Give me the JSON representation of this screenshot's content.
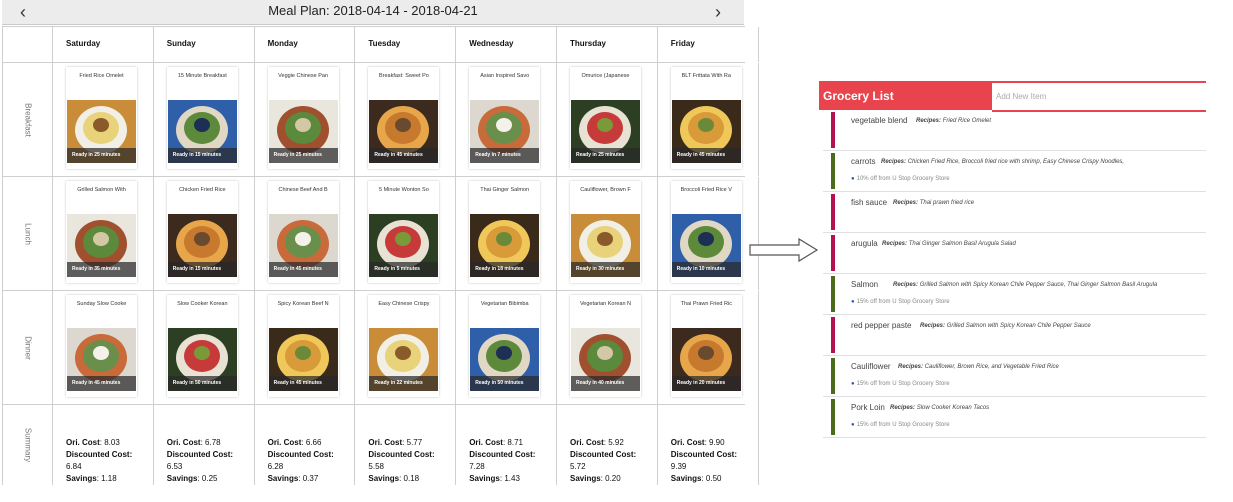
{
  "plan": {
    "title": "Meal Plan: 2018-04-14 - 2018-04-21",
    "prev": "‹",
    "next": "›",
    "days": [
      "Saturday",
      "Sunday",
      "Monday",
      "Tuesday",
      "Wednesday",
      "Thursday",
      "Friday"
    ],
    "meals": [
      {
        "label": "Breakfast",
        "items": [
          {
            "name": "Fried Rice Omelet",
            "ready": "Ready in 25 minutes"
          },
          {
            "name": "15 Minute Breakfast",
            "ready": "Ready in 15 minutes"
          },
          {
            "name": "Veggie Chinese Pan",
            "ready": "Ready in 25 minutes"
          },
          {
            "name": "Breakfast: Sweet Po",
            "ready": "Ready in 45 minutes"
          },
          {
            "name": "Asian Inspired Savo",
            "ready": "Ready in 7 minutes"
          },
          {
            "name": "Omurice (Japanese",
            "ready": "Ready in 25 minutes"
          },
          {
            "name": "BLT Frittata With Ra",
            "ready": "Ready in 45 minutes"
          }
        ]
      },
      {
        "label": "Lunch",
        "items": [
          {
            "name": "Grilled Salmon With",
            "ready": "Ready in 35 minutes"
          },
          {
            "name": "Chicken Fried Rice",
            "ready": "Ready in 15 minutes"
          },
          {
            "name": "Chinese Beef And B",
            "ready": "Ready in 45 minutes"
          },
          {
            "name": "5 Minute Wonton So",
            "ready": "Ready in 5 minutes"
          },
          {
            "name": "Thai Ginger Salmon",
            "ready": "Ready in 18 minutes"
          },
          {
            "name": "Cauliflower, Brown F",
            "ready": "Ready in 30 minutes"
          },
          {
            "name": "Broccoli Fried Rice V",
            "ready": "Ready in 10 minutes"
          }
        ]
      },
      {
        "label": "Dinner",
        "items": [
          {
            "name": "Sunday Slow Cooke",
            "ready": "Ready in 45 minutes"
          },
          {
            "name": "Slow Cooker Korean",
            "ready": "Ready in 50 minutes"
          },
          {
            "name": "Spicy Korean Beef N",
            "ready": "Ready in 45 minutes"
          },
          {
            "name": "Easy Chinese Crispy",
            "ready": "Ready in 22 minutes"
          },
          {
            "name": "Vegetarian Bibimba",
            "ready": "Ready in 50 minutes"
          },
          {
            "name": "Vegetarian Korean N",
            "ready": "Ready in 40 minutes"
          },
          {
            "name": "Thai Prawn Fried Ric",
            "ready": "Ready in 20 minutes"
          }
        ]
      }
    ],
    "summary": {
      "label": "Summary",
      "ori_label": "Ori. Cost",
      "disc_label": "Discounted Cost",
      "sav_label": "Savings",
      "days": [
        {
          "ori": ": 8.03",
          "disc": "6.84",
          "sav": ": 1.18"
        },
        {
          "ori": ": 6.78",
          "disc": "6.53",
          "sav": ": 0.25"
        },
        {
          "ori": ": 6.66",
          "disc": "6.28",
          "sav": ": 0.37"
        },
        {
          "ori": ": 5.77",
          "disc": "5.58",
          "sav": ": 0.18"
        },
        {
          "ori": ": 8.71",
          "disc": "7.28",
          "sav": ": 1.43"
        },
        {
          "ori": ": 5.92",
          "disc": "5.72",
          "sav": ": 0.20"
        },
        {
          "ori": ": 9.90",
          "disc": "9.39",
          "sav": ": 0.50"
        }
      ]
    }
  },
  "grocery": {
    "title": "Grocery List",
    "input_placeholder": "Add New Item",
    "recipes_label": "Recipes:",
    "items": [
      {
        "name": "vegetable blend",
        "recipes": "Fried Rice Omelet",
        "promo": "",
        "accent": "#b5104f"
      },
      {
        "name": "carrots",
        "recipes": "Chicken Fried Rice, Broccoli fried rice with shrimp, Easy Chinese Crispy Noodles,",
        "promo": "10% off from U Stop Grocery Store",
        "accent": "#4a6b1b"
      },
      {
        "name": "fish sauce",
        "recipes": "Thai prawn fried rice",
        "promo": "",
        "accent": "#b5104f"
      },
      {
        "name": "arugula",
        "recipes": "Thai Ginger Salmon Basil Arugula Salad",
        "promo": "",
        "accent": "#b5104f"
      },
      {
        "name": "Salmon",
        "recipes": "Grilled Salmon with Spicy Korean Chile Pepper Sauce, Thai Ginger Salmon Basil Arugula",
        "promo": "15% off from U Stop Grocery Store",
        "accent": "#4a6b1b"
      },
      {
        "name": "red pepper paste",
        "recipes": "Grilled Salmon with Spicy Korean Chile Pepper Sauce",
        "promo": "",
        "accent": "#b5104f"
      },
      {
        "name": "Cauliflower",
        "recipes": "Cauliflower, Brown Rice, and Vegetable Fried Rice",
        "promo": "15% off from U Stop Grocery Store",
        "accent": "#4a6b1b"
      },
      {
        "name": "Pork Loin",
        "recipes": "Slow Cooker Korean Tacos",
        "promo": "15% off from U Stop Grocery Store",
        "accent": "#4a6b1b"
      }
    ]
  },
  "colors": {
    "grocery_accent": "#e9434d",
    "promo_tag": "#2a55b0"
  }
}
